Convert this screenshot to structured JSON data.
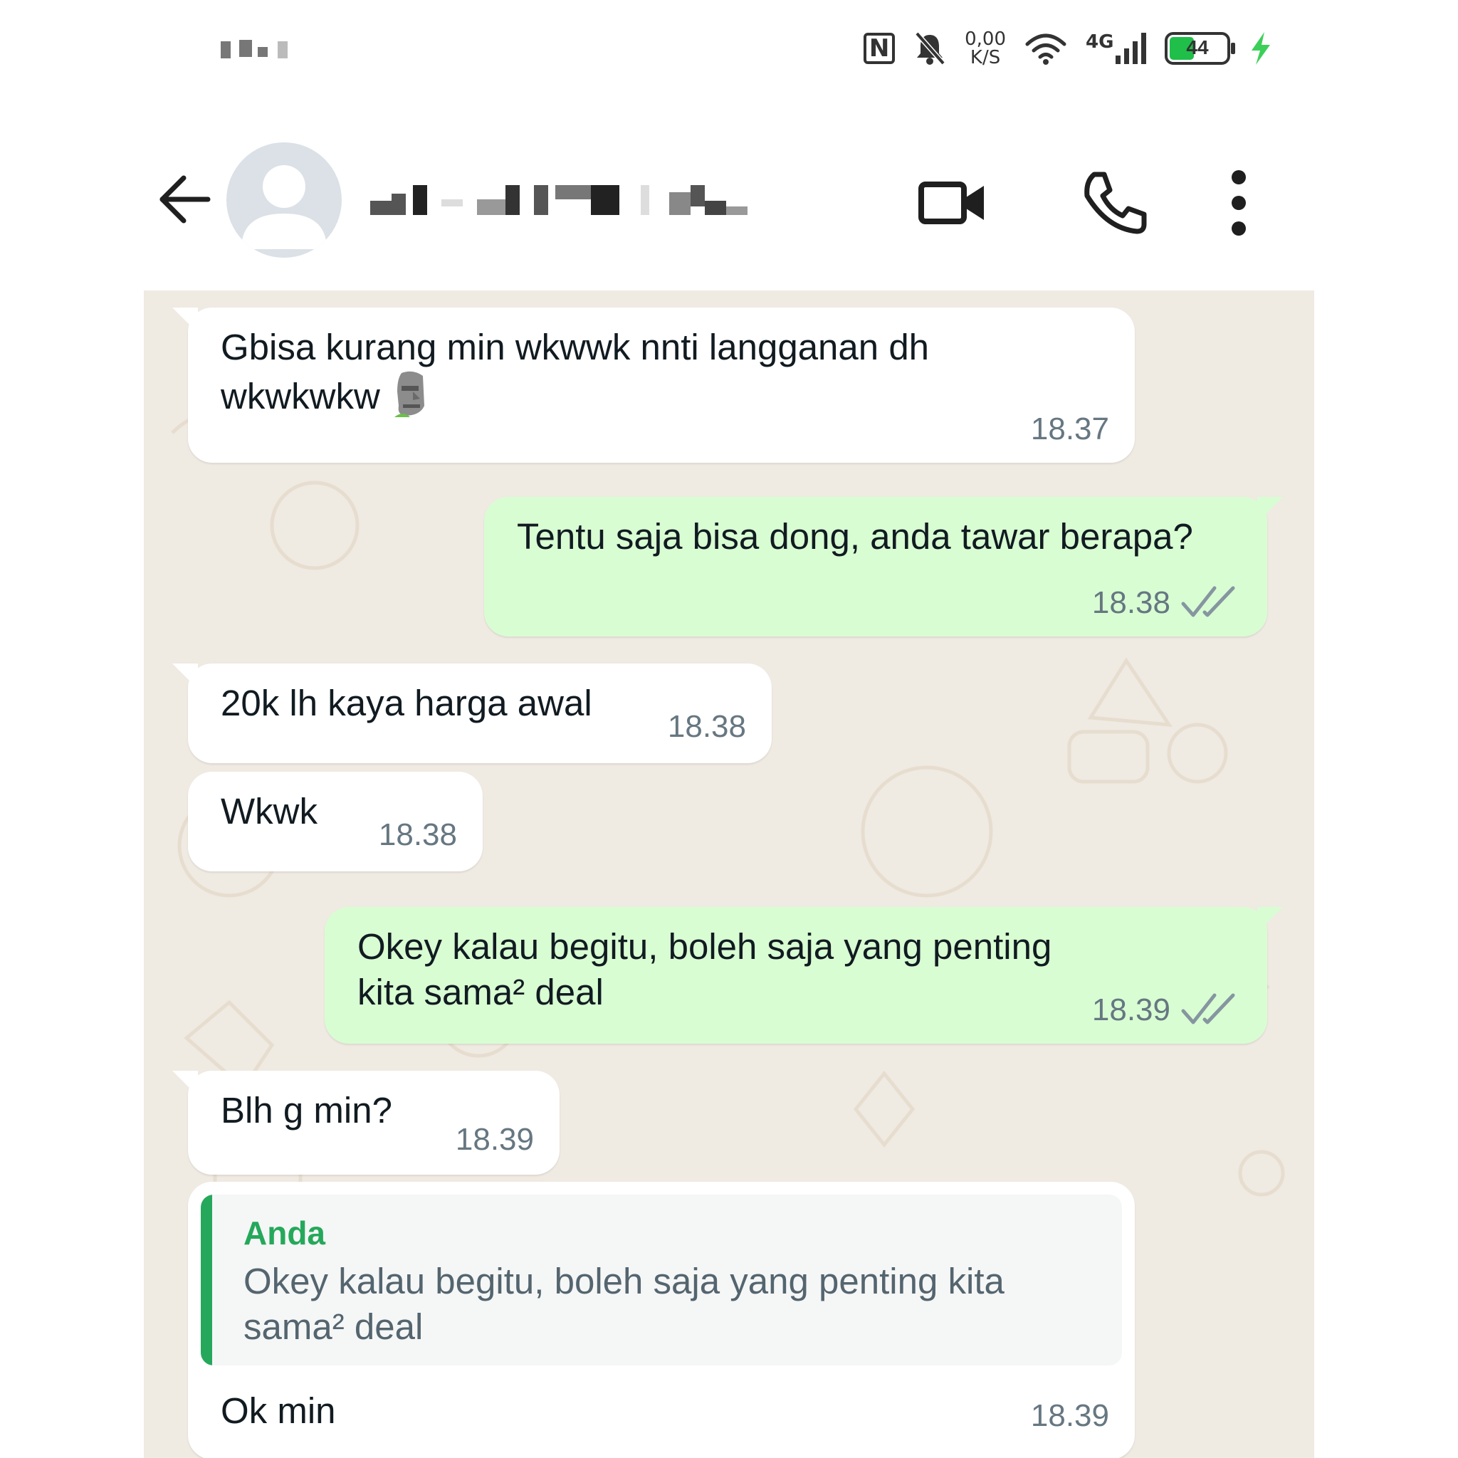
{
  "status_bar": {
    "net_speed_value": "0,00",
    "net_speed_unit": "K/S",
    "network_type": "4G",
    "battery_percent": "44",
    "battery_level": 0.44,
    "icons": [
      "nfc-icon",
      "mute-icon",
      "wifi-icon",
      "signal-icon",
      "battery-icon",
      "charging-icon"
    ]
  },
  "header": {
    "contact_name": "",
    "icons": [
      "back-arrow-icon",
      "avatar-icon",
      "video-call-icon",
      "voice-call-icon",
      "more-menu-icon"
    ]
  },
  "colors": {
    "incoming_bubble": "#ffffff",
    "outgoing_bubble": "#d9fdd3",
    "chat_background": "#efeae2",
    "quote_accent": "#25a85b",
    "timestamp": "#667781"
  },
  "messages": [
    {
      "direction": "in",
      "text": "Gbisa kurang min wkwwk nnti langganan dh",
      "text2": "wkwkwkw",
      "emoji": "moai-emoji",
      "time": "18.37"
    },
    {
      "direction": "out",
      "text": "Tentu saja bisa dong, anda tawar berapa?",
      "time": "18.38",
      "status_icon": "double-check-icon"
    },
    {
      "direction": "in",
      "text": "20k lh kaya harga awal",
      "time": "18.38"
    },
    {
      "direction": "in",
      "text": "Wkwk",
      "time": "18.38"
    },
    {
      "direction": "out",
      "text": "Okey kalau begitu, boleh saja yang penting kita sama² deal",
      "time": "18.39",
      "status_icon": "double-check-icon"
    },
    {
      "direction": "in",
      "text": "Blh g min?",
      "time": "18.39"
    },
    {
      "direction": "in",
      "quote_author": "Anda",
      "quote_text": "Okey kalau begitu, boleh saja yang penting kita sama² deal",
      "text": "Ok min",
      "time": "18.39"
    }
  ]
}
